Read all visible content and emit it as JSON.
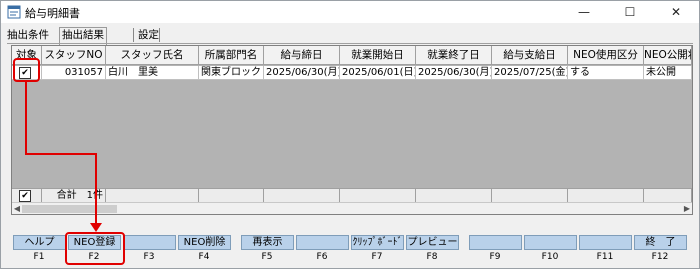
{
  "window": {
    "title": "給与明細書",
    "minimize": "—",
    "maximize": "☐",
    "close": "✕"
  },
  "tabs": [
    {
      "label": "抽出条件"
    },
    {
      "label": "抽出結果"
    },
    {
      "label": "設定"
    }
  ],
  "grid": {
    "columns": [
      "対象",
      "スタッフNO",
      "スタッフ氏名",
      "所属部門名",
      "給与締日",
      "就業開始日",
      "就業終了日",
      "給与支給日",
      "NEO使用区分",
      "NEO公開状"
    ],
    "row": {
      "selected": "✔",
      "staff_no": "031057",
      "staff_name": "白川　里美",
      "department": "関東ブロック",
      "closing_date": "2025/06/30(月)",
      "work_start": "2025/06/01(日)",
      "work_end": "2025/06/30(月)",
      "pay_date": "2025/07/25(金)",
      "neo_use": "する",
      "neo_public": "未公開"
    },
    "footer": {
      "check": "✔",
      "total": "合計　1件"
    }
  },
  "function_keys": [
    {
      "label": "ヘルプ",
      "key": "F1"
    },
    {
      "label": "NEO登録",
      "key": "F2"
    },
    {
      "label": "",
      "key": "F3"
    },
    {
      "label": "NEO削除",
      "key": "F4"
    },
    {
      "label": "再表示",
      "key": "F5"
    },
    {
      "label": "",
      "key": "F6"
    },
    {
      "label": "ｸﾘｯﾌﾟﾎﾞｰﾄﾞ",
      "key": "F7"
    },
    {
      "label": "プレビュー",
      "key": "F8"
    },
    {
      "label": "",
      "key": "F9"
    },
    {
      "label": "",
      "key": "F10"
    },
    {
      "label": "",
      "key": "F11"
    },
    {
      "label": "終　了",
      "key": "F12"
    }
  ],
  "colors": {
    "annotation": "#e00000",
    "fkey_button": "#b9d1ea",
    "grid_background": "#b3b3b3"
  }
}
